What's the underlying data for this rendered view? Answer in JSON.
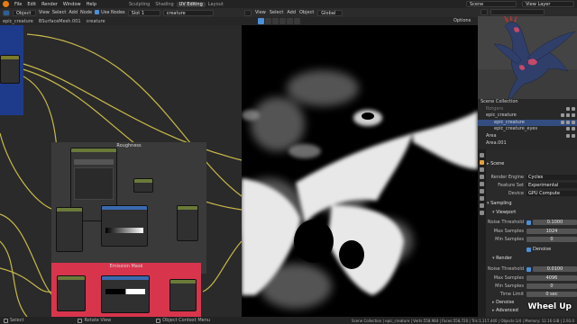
{
  "topbar": {
    "menus": [
      "File",
      "Edit",
      "Render",
      "Window",
      "Help"
    ],
    "workspaces": [
      "Sculpting",
      "Shading",
      "UV Editing",
      "Layout"
    ],
    "active_workspace": "UV Editing",
    "scene_label": "Scene",
    "view_layer_label": "View Layer"
  },
  "node_editor": {
    "editor_type": "Object",
    "menus": [
      "View",
      "Select",
      "Add",
      "Node"
    ],
    "use_nodes_label": "Use Nodes",
    "slot": "Slot 1",
    "material": "creature",
    "breadcrumb": [
      "epic_creature",
      "BSurfaceMesh.001",
      "creature"
    ],
    "frames": {
      "roughness": "Roughness",
      "emission": "Emission Mask"
    }
  },
  "viewport": {
    "menus": [
      "View",
      "Select",
      "Add",
      "Object"
    ],
    "transform": "Global",
    "options": "Options"
  },
  "outliner": {
    "header": "Scene Collection",
    "rows": [
      {
        "label": "Scene Collection",
        "indent": 0,
        "selected": false
      },
      {
        "label": "Rotgers",
        "indent": 1,
        "selected": false,
        "dim": true
      },
      {
        "label": "epic_creature",
        "indent": 1,
        "selected": false
      },
      {
        "label": "epic_creature",
        "indent": 2,
        "selected": true
      },
      {
        "label": "epic_creature_eyes",
        "indent": 2,
        "selected": false
      },
      {
        "label": "Area",
        "indent": 1,
        "selected": false
      },
      {
        "label": "Area.001",
        "indent": 1,
        "selected": false
      }
    ]
  },
  "properties": {
    "scene_label": "Scene",
    "render_engine_label": "Render Engine",
    "render_engine": "Cycles",
    "feature_set_label": "Feature Set",
    "feature_set": "Experimental",
    "device_label": "Device",
    "device": "GPU Compute",
    "sampling": "Sampling",
    "viewport_section": "Viewport",
    "noise_threshold_label": "Noise Threshold",
    "viewport_noise_threshold": "0.1000",
    "max_samples_label": "Max Samples",
    "viewport_max_samples": "1024",
    "min_samples_label": "Min Samples",
    "viewport_min_samples": "0",
    "denoise_label": "Denoise",
    "render_section": "Render",
    "render_noise_threshold": "0.0100",
    "render_max_samples": "4096",
    "render_min_samples": "0",
    "time_limit_label": "Time Limit",
    "time_limit": "0 sec",
    "denoise_closed": "Denoise",
    "advanced": "Advanced"
  },
  "statusbar": {
    "select": "Select",
    "rotate": "Rotate View",
    "context": "Object Context Menu",
    "stats": "Scene Collection | epic_creature | Verts:558,984 | Faces:558,720 | Tris:1,117,440 | Objects:1/4 | Memory: 12.16 GiB | 2.93.0"
  },
  "overlay": {
    "wheel": "Wheel Up"
  },
  "colors": {
    "accent": "#4a90d9",
    "selection": "#334d80",
    "emission_frame": "#d8354d",
    "blue_frame": "#1e3a8a",
    "wire": "#c8b84a"
  }
}
